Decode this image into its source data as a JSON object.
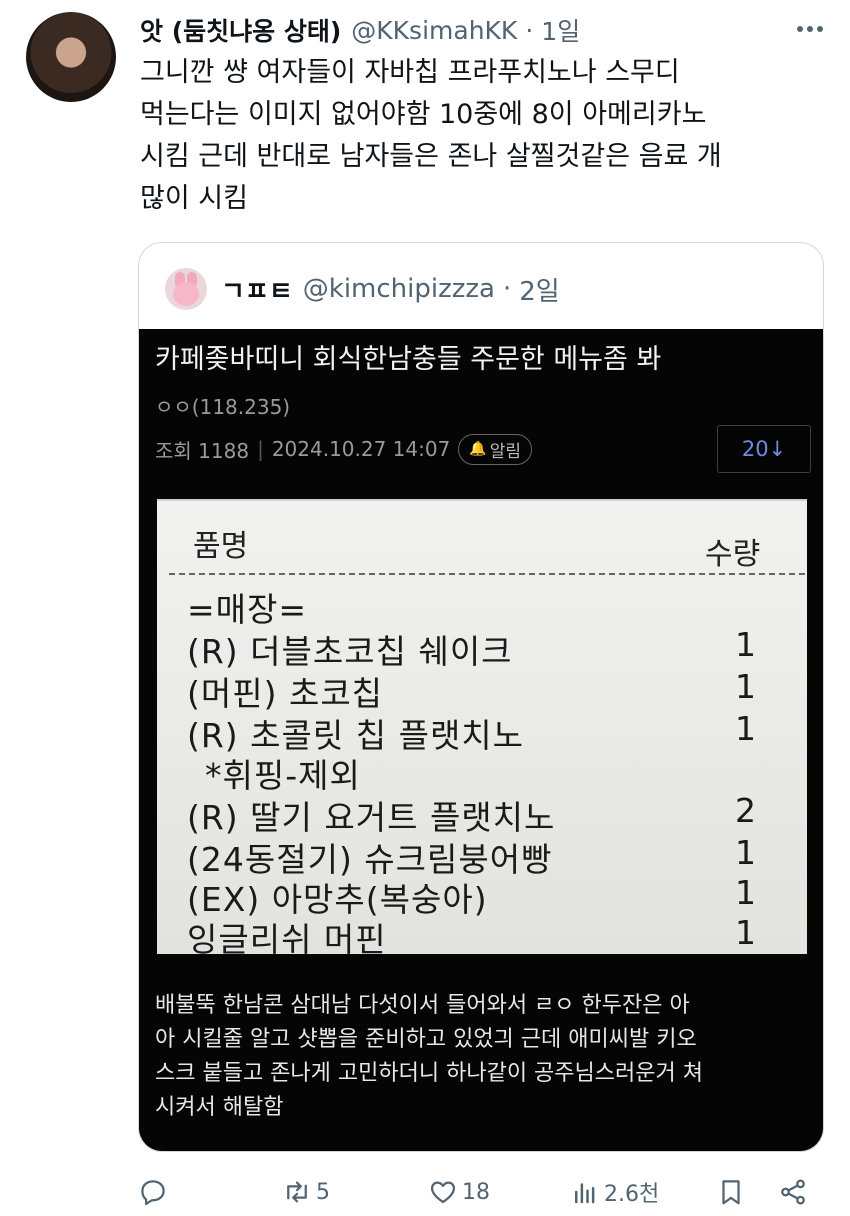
{
  "tweet": {
    "display_name": "앗 (둠칫냐옹 상태)",
    "handle": "@KKsimahKK",
    "separator": "·",
    "time": "1일",
    "more_icon": "more-dots-icon",
    "text_lines": [
      "그니깐 썅 여자들이 자바칩 프라푸치노나 스무디",
      "먹는다는 이미지 없어야함 10중에 8이 아메리카노",
      "시킴 근데 반대로 남자들은 존나 살찔것같은 음료 개",
      "많이 시킴"
    ]
  },
  "quote": {
    "display_name": "ㄱㅍㅌ",
    "handle": "@kimchipizzza",
    "separator": "·",
    "time": "2일",
    "community": {
      "title": "카페좆바띠니 회식한남충들 주문한 메뉴좀 봐",
      "author": "ㅇㅇ(118.235)",
      "views_label": "조회 1188",
      "datetime": "2024.10.27 14:07",
      "alarm_label": "알림",
      "comment_count": "20↓",
      "receipt": {
        "header_item": "품명",
        "header_qty": "수량",
        "rows": [
          {
            "item": "=매장=",
            "qty": ""
          },
          {
            "item": "(R) 더블초코칩 쉐이크",
            "qty": "1"
          },
          {
            "item": "(머핀) 초코칩",
            "qty": "1"
          },
          {
            "item": "(R) 초콜릿 칩 플랫치노",
            "qty": "1"
          },
          {
            "item": "  *휘핑-제외",
            "qty": ""
          },
          {
            "item": "(R) 딸기 요거트 플랫치노",
            "qty": "2"
          },
          {
            "item": "(24동절기) 슈크림붕어빵",
            "qty": "1"
          },
          {
            "item": "(EX) 아망추(복숭아)",
            "qty": "1"
          },
          {
            "item": "잉글리쉬 머핀",
            "qty": "1"
          }
        ]
      },
      "body_lines": [
        "배불뚝 한남콘 삼대남 다섯이서 들어와서 ㄹㅇ 한두잔은 아",
        "아 시킬줄 알고 샷뽑을 준비하고 있었긔 근데 애미씨발 키오",
        "스크 붙들고 존나게 고민하더니 하나같이 공주님스러운거 쳐",
        "시켜서 해탈함"
      ]
    }
  },
  "actions": {
    "reply_icon": "reply-icon",
    "retweet_icon": "retweet-icon",
    "retweets": "5",
    "like_icon": "heart-icon",
    "likes": "18",
    "views_icon": "views-icon",
    "views": "2.6천",
    "bookmark_icon": "bookmark-icon",
    "share_icon": "share-icon"
  }
}
